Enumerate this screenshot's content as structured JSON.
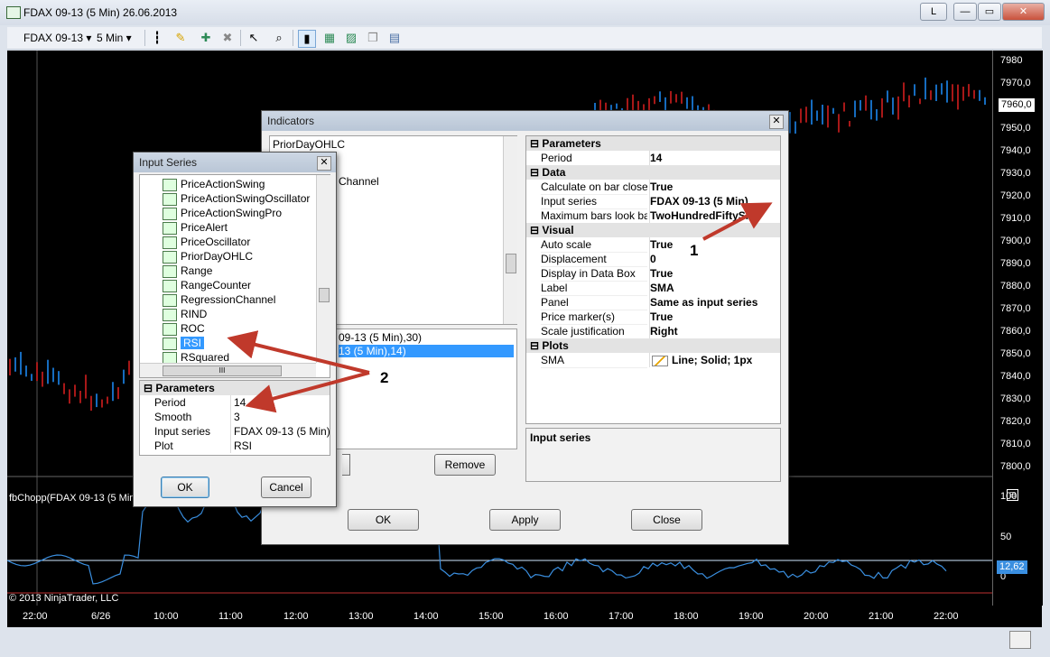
{
  "window": {
    "title": "FDAX 09-13 (5 Min)  26.06.2013",
    "buttons": {
      "layout": "L",
      "minimize": "—",
      "restore": "▭",
      "close": "✕"
    }
  },
  "toolbar": {
    "instrument": "FDAX 09-13",
    "interval": "5 Min"
  },
  "chart": {
    "price_axis": [
      "7980",
      "7970,0",
      "7960,0",
      "7950,0",
      "7940,0",
      "7930,0",
      "7920,0",
      "7910,0",
      "7900,0",
      "7890,0",
      "7880,0",
      "7870,0",
      "7860,0",
      "7850,0",
      "7840,0",
      "7830,0",
      "7820,0",
      "7810,0",
      "7800,0"
    ],
    "last_price": "7960,0",
    "lower_panel_label": "fbChopp(FDAX 09-13 (5 Min",
    "lower_axis": [
      "100",
      "50",
      "0"
    ],
    "lower_value": "12,62",
    "copyright": "© 2013 NinjaTrader, LLC",
    "time_axis": [
      "22:00",
      "6/26",
      "10:00",
      "11:00",
      "12:00",
      "13:00",
      "14:00",
      "15:00",
      "16:00",
      "17:00",
      "18:00",
      "19:00",
      "20:00",
      "21:00",
      "22:00"
    ],
    "colors": {
      "up": "#1e90ff",
      "down": "#e02020",
      "osc": "#3a8fe0",
      "background": "#000000"
    }
  },
  "indicators_dialog": {
    "title": "Indicators",
    "list_top": [
      "PriorDayOHLC",
      "Channel"
    ],
    "applied": [
      "09-13 (5 Min),30)",
      "13 (5 Min),14)"
    ],
    "remove_label": "Remove",
    "ok_label": "OK",
    "apply_label": "Apply",
    "close_label": "Close",
    "description_title": "Input series",
    "grid": {
      "parameters": {
        "header": "Parameters",
        "rows": [
          {
            "name": "Period",
            "value": "14"
          }
        ]
      },
      "data": {
        "header": "Data",
        "rows": [
          {
            "name": "Calculate on bar close",
            "value": "True"
          },
          {
            "name": "Input series",
            "value": "FDAX 09-13 (5 Min)"
          },
          {
            "name": "Maximum bars look bac",
            "value": "TwoHundredFiftySix"
          }
        ]
      },
      "visual": {
        "header": "Visual",
        "rows": [
          {
            "name": "Auto scale",
            "value": "True"
          },
          {
            "name": "Displacement",
            "value": "0"
          },
          {
            "name": "Display in Data Box",
            "value": "True"
          },
          {
            "name": "Label",
            "value": "SMA"
          },
          {
            "name": "Panel",
            "value": "Same as input series"
          },
          {
            "name": "Price marker(s)",
            "value": "True"
          },
          {
            "name": "Scale justification",
            "value": "Right"
          }
        ]
      },
      "plots": {
        "header": "Plots",
        "rows": [
          {
            "name": "SMA",
            "value": "Line; Solid; 1px"
          }
        ]
      }
    }
  },
  "input_series_dialog": {
    "title": "Input Series",
    "items": [
      "PriceActionSwing",
      "PriceActionSwingOscillator",
      "PriceActionSwingPro",
      "PriceAlert",
      "PriceOscillator",
      "PriorDayOHLC",
      "Range",
      "RangeCounter",
      "RegressionChannel",
      "RIND",
      "ROC",
      "RSI",
      "RSquared"
    ],
    "selected_index": 11,
    "hscroll_label": "III",
    "parameters_header": "Parameters",
    "params": [
      {
        "name": "Period",
        "value": "14"
      },
      {
        "name": "Smooth",
        "value": "3"
      },
      {
        "name": "Input series",
        "value": "FDAX 09-13 (5 Min)"
      },
      {
        "name": "Plot",
        "value": "RSI"
      }
    ],
    "ok_label": "OK",
    "cancel_label": "Cancel"
  },
  "annotations": {
    "label1": "1",
    "label2": "2",
    "arrow_color": "#c0392b"
  }
}
